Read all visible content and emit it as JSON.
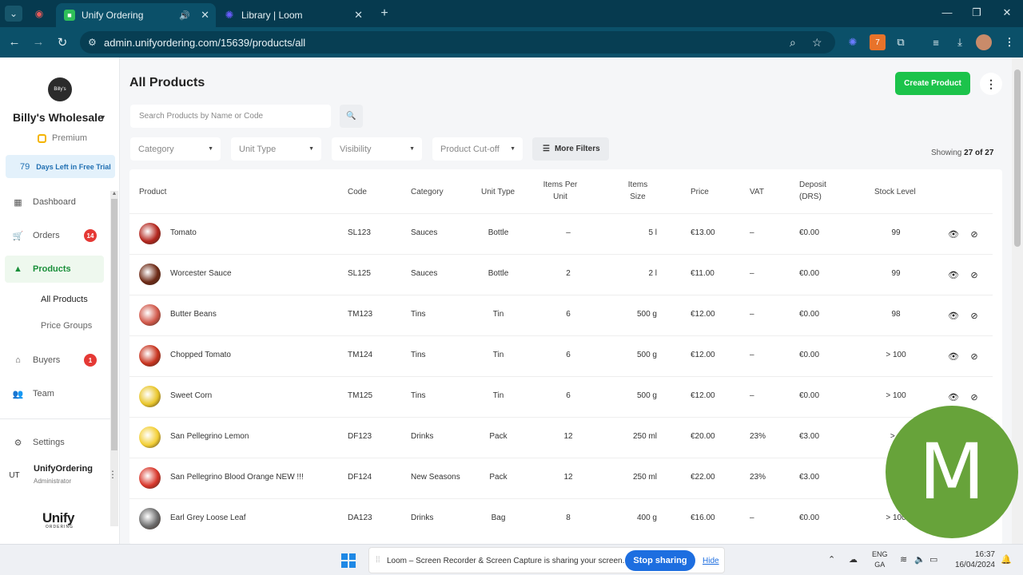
{
  "browser": {
    "tabs": [
      {
        "title": "Unify Ordering",
        "active": true
      },
      {
        "title": "Library | Loom",
        "active": false
      }
    ],
    "url": "admin.unifyordering.com/15639/products/all",
    "extension_badge": "7"
  },
  "sidebar": {
    "logo_text": "Billy's",
    "org_name": "Billy's Wholesale",
    "plan": "Premium",
    "trial": {
      "days": "79",
      "label": "Days Left in Free Trial"
    },
    "nav": [
      {
        "label": "Dashboard",
        "icon": "dashboard-icon"
      },
      {
        "label": "Orders",
        "icon": "cart-icon",
        "badge": "14"
      },
      {
        "label": "Products",
        "icon": "products-icon",
        "active": true
      },
      {
        "label": "Buyers",
        "icon": "store-icon",
        "badge": "1"
      },
      {
        "label": "Team",
        "icon": "team-icon"
      },
      {
        "label": "Settings",
        "icon": "gear-icon"
      }
    ],
    "sub_nav": [
      {
        "label": "All Products",
        "active": true
      },
      {
        "label": "Price Groups",
        "active": false
      }
    ],
    "user": {
      "initials": "UT",
      "name": "UnifyOrdering",
      "role": "Administrator"
    },
    "brand": {
      "name": "Unify",
      "sub": "ORDERING"
    }
  },
  "main": {
    "title": "All Products",
    "create_label": "Create Product",
    "search_placeholder": "Search Products by Name or Code",
    "filters": [
      "Category",
      "Unit Type",
      "Visibility",
      "Product Cut-off"
    ],
    "more_filters_label": "More Filters",
    "showing": {
      "prefix": "Showing",
      "value": "27 of 27"
    },
    "columns": {
      "product": "Product",
      "code": "Code",
      "category": "Category",
      "unit_type": "Unit Type",
      "items_per_unit": [
        "Items Per",
        "Unit"
      ],
      "items_size": [
        "Items",
        "Size"
      ],
      "price": "Price",
      "vat": "VAT",
      "deposit": [
        "Deposit",
        "(DRS)"
      ],
      "stock": "Stock Level"
    },
    "rows": [
      {
        "name": "Tomato",
        "code": "SL123",
        "category": "Sauces",
        "unit": "Bottle",
        "per_unit": "–",
        "size": "5 l",
        "price": "€13.00",
        "vat": "–",
        "deposit": "€0.00",
        "stock": "99",
        "color": "#b3261e"
      },
      {
        "name": "Worcester Sauce",
        "code": "SL125",
        "category": "Sauces",
        "unit": "Bottle",
        "per_unit": "2",
        "size": "2 l",
        "price": "€11.00",
        "vat": "–",
        "deposit": "€0.00",
        "stock": "99",
        "color": "#6d2a16"
      },
      {
        "name": "Butter Beans",
        "code": "TM123",
        "category": "Tins",
        "unit": "Tin",
        "per_unit": "6",
        "size": "500 g",
        "price": "€12.00",
        "vat": "–",
        "deposit": "€0.00",
        "stock": "98",
        "color": "#d1584a"
      },
      {
        "name": "Chopped Tomato",
        "code": "TM124",
        "category": "Tins",
        "unit": "Tin",
        "per_unit": "6",
        "size": "500 g",
        "price": "€12.00",
        "vat": "–",
        "deposit": "€0.00",
        "stock": "> 100",
        "color": "#c8341f"
      },
      {
        "name": "Sweet Corn",
        "code": "TM125",
        "category": "Tins",
        "unit": "Tin",
        "per_unit": "6",
        "size": "500 g",
        "price": "€12.00",
        "vat": "–",
        "deposit": "€0.00",
        "stock": "> 100",
        "color": "#e9c62a"
      },
      {
        "name": "San Pellegrino Lemon",
        "code": "DF123",
        "category": "Drinks",
        "unit": "Pack",
        "per_unit": "12",
        "size": "250 ml",
        "price": "€20.00",
        "vat": "23%",
        "deposit": "€3.00",
        "stock": "> 1",
        "color": "#f3cf35"
      },
      {
        "name": "San Pellegrino Blood Orange NEW !!!",
        "code": "DF124",
        "category": "New Seasons",
        "unit": "Pack",
        "per_unit": "12",
        "size": "250 ml",
        "price": "€22.00",
        "vat": "23%",
        "deposit": "€3.00",
        "stock": "",
        "color": "#d8372b"
      },
      {
        "name": "Earl Grey Loose Leaf",
        "code": "DA123",
        "category": "Drinks",
        "unit": "Bag",
        "per_unit": "8",
        "size": "400 g",
        "price": "€16.00",
        "vat": "–",
        "deposit": "€0.00",
        "stock": "> 100",
        "color": "#6c6c6c"
      }
    ]
  },
  "overlay": {
    "letter": "M",
    "color": "#67a33a"
  },
  "taskbar": {
    "share_text": "Loom – Screen Recorder & Screen Capture is sharing your screen.",
    "stop_label": "Stop sharing",
    "hide_label": "Hide",
    "lang": [
      "ENG",
      "GA"
    ],
    "time": "16:37",
    "date": "16/04/2024"
  }
}
